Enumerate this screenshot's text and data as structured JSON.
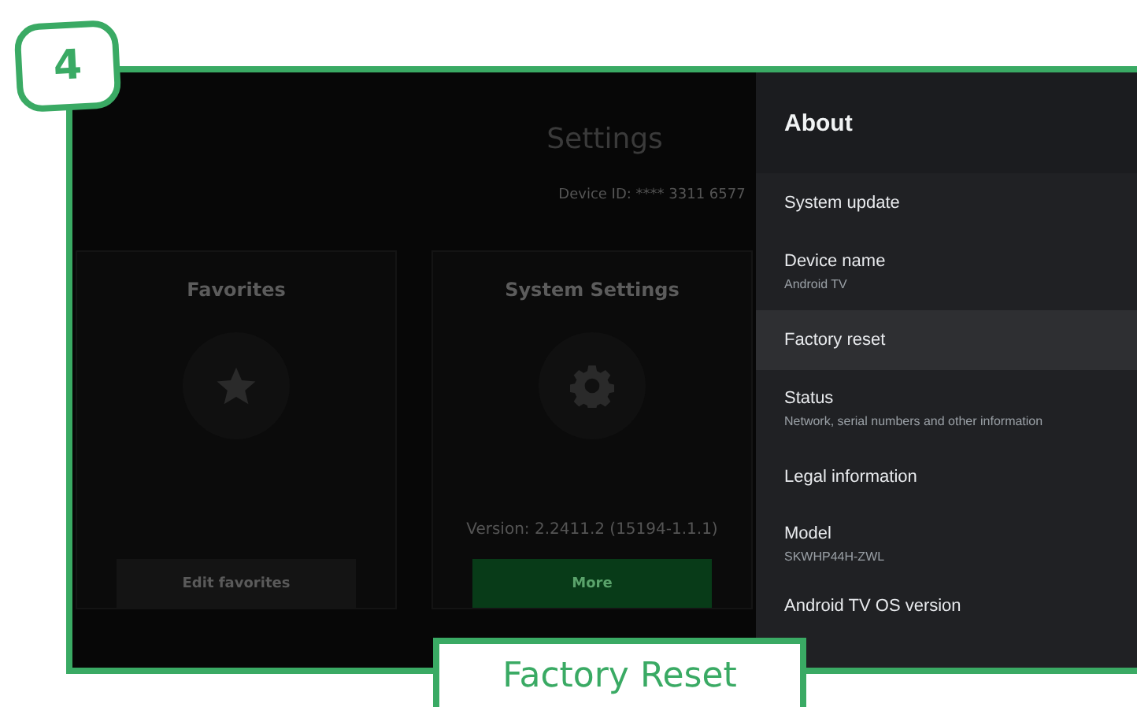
{
  "step_badge": "4",
  "caption": "Factory Reset",
  "screen": {
    "title": "Settings",
    "device_id": "Device ID: **** 3311 6577",
    "cards": [
      {
        "kind": "favorites",
        "title": "Favorites",
        "button": {
          "label": "Edit favorites",
          "primary": false
        }
      },
      {
        "kind": "system",
        "title": "System Settings",
        "version": "Version: 2.2411.2 (15194-1.1.1)",
        "button": {
          "label": "More",
          "primary": true
        }
      }
    ]
  },
  "panel": {
    "title": "About",
    "items": [
      {
        "label": "System update",
        "selected": false
      },
      {
        "label": "Device name",
        "detail": "Android TV",
        "selected": false
      },
      {
        "label": "Factory reset",
        "selected": true
      },
      {
        "label": "Status",
        "detail": "Network, serial numbers and other information",
        "selected": false
      },
      {
        "label": "Legal information",
        "selected": false
      },
      {
        "label": "Model",
        "detail": "SKWHP44H-ZWL",
        "selected": false
      },
      {
        "label": "Android TV OS version",
        "selected": false
      }
    ]
  }
}
